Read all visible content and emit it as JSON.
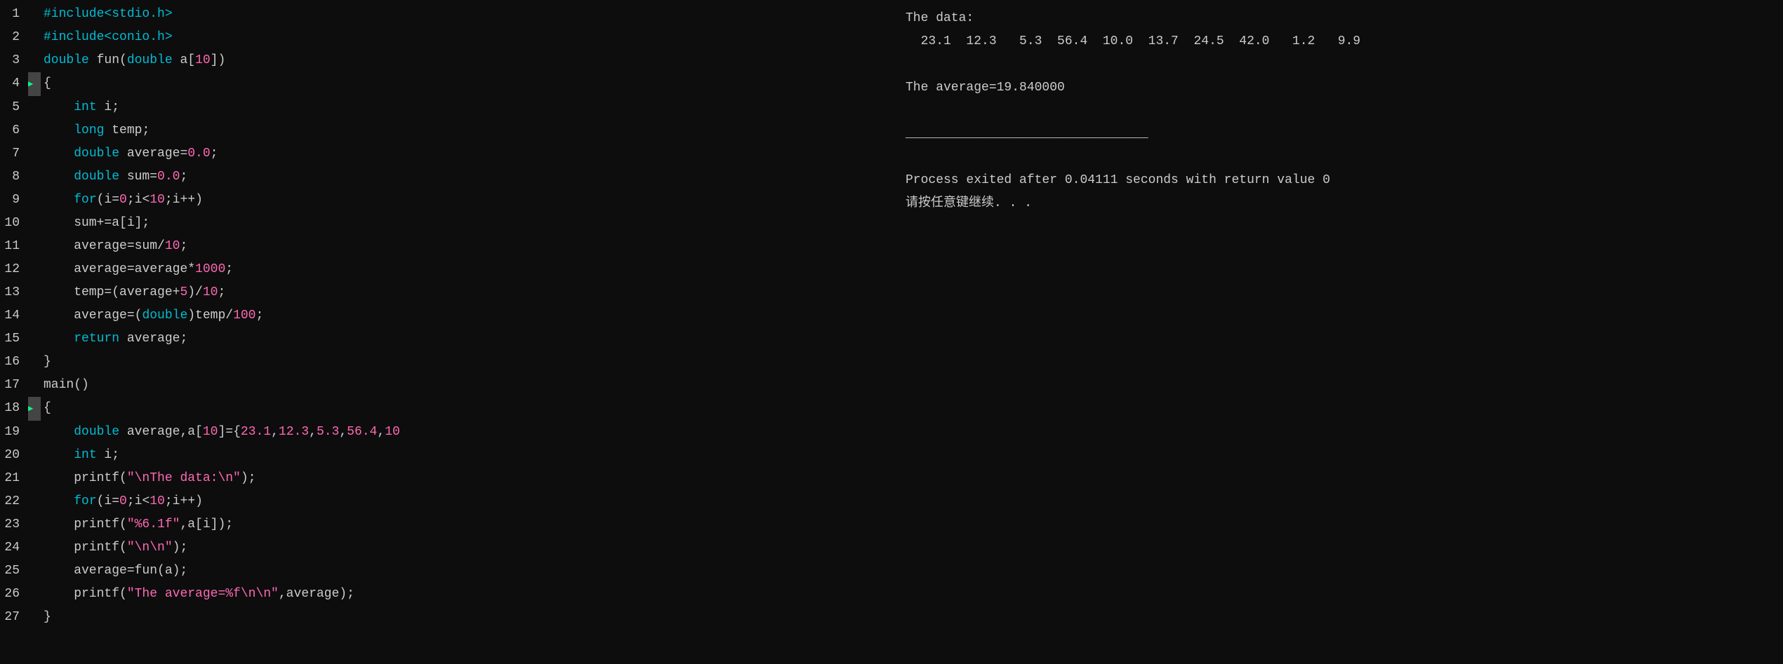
{
  "editor": {
    "lines": [
      {
        "num": 1,
        "marker": "",
        "content": "<span class='kw-include'>#include&lt;stdio.h&gt;</span>"
      },
      {
        "num": 2,
        "marker": "",
        "content": "<span class='kw-include'>#include&lt;conio.h&gt;</span>"
      },
      {
        "num": 3,
        "marker": "",
        "content": "<span class='kw-type'>double</span> fun(<span class='kw-type'>double</span> a[<span class='num-val'>10</span>])"
      },
      {
        "num": 4,
        "marker": "■",
        "content": "{"
      },
      {
        "num": 5,
        "marker": "",
        "content": "    <span class='kw-type'>int</span> i;"
      },
      {
        "num": 6,
        "marker": "",
        "content": "    <span class='kw-type'>long</span> temp;"
      },
      {
        "num": 7,
        "marker": "",
        "content": "    <span class='kw-type'>double</span> average=<span class='num-val'>0.0</span>;"
      },
      {
        "num": 8,
        "marker": "",
        "content": "    <span class='kw-type'>double</span> sum=<span class='num-val'>0.0</span>;"
      },
      {
        "num": 9,
        "marker": "",
        "content": "    <span class='kw-for'>for</span>(i=<span class='num-val'>0</span>;i&lt;<span class='num-val'>10</span>;i++)"
      },
      {
        "num": 10,
        "marker": "",
        "content": "    sum+=a[i];"
      },
      {
        "num": 11,
        "marker": "",
        "content": "    average=sum/<span class='num-val'>10</span>;"
      },
      {
        "num": 12,
        "marker": "",
        "content": "    average=average*<span class='num-val'>1000</span>;"
      },
      {
        "num": 13,
        "marker": "",
        "content": "    temp=(average+<span class='num-val'>5</span>)/<span class='num-val'>10</span>;"
      },
      {
        "num": 14,
        "marker": "",
        "content": "    average=(<span class='kw-type'>double</span>)temp/<span class='num-val'>100</span>;"
      },
      {
        "num": 15,
        "marker": "",
        "content": "    <span class='kw-return'>return</span> average;"
      },
      {
        "num": 16,
        "marker": "",
        "content": "}"
      },
      {
        "num": 17,
        "marker": "",
        "content": "main()"
      },
      {
        "num": 18,
        "marker": "■",
        "content": "{"
      },
      {
        "num": 19,
        "marker": "",
        "content": "    <span class='kw-type'>double</span> average,a[<span class='num-val'>10</span>]={<span class='num-val'>23.1</span>,<span class='num-val'>12.3</span>,<span class='num-val'>5.3</span>,<span class='num-val'>56.4</span>,<span class='num-val'>10</span>"
      },
      {
        "num": 20,
        "marker": "",
        "content": "    <span class='kw-type'>int</span> i;"
      },
      {
        "num": 21,
        "marker": "",
        "content": "    printf(<span class='str-val'>&quot;\\nThe data:\\n&quot;</span>);"
      },
      {
        "num": 22,
        "marker": "",
        "content": "    <span class='kw-for'>for</span>(i=<span class='num-val'>0</span>;i&lt;<span class='num-val'>10</span>;i++)"
      },
      {
        "num": 23,
        "marker": "",
        "content": "    printf(<span class='str-val'>&quot;%6.1f&quot;</span>,a[i]);"
      },
      {
        "num": 24,
        "marker": "",
        "content": "    printf(<span class='str-val'>&quot;\\n\\n&quot;</span>);"
      },
      {
        "num": 25,
        "marker": "",
        "content": "    average=fun(a);"
      },
      {
        "num": 26,
        "marker": "",
        "content": "    printf(<span class='str-val'>&quot;The average=%f\\n\\n&quot;</span>,average);"
      },
      {
        "num": 27,
        "marker": "",
        "content": "}"
      }
    ]
  },
  "output": {
    "lines": [
      {
        "text": "The data:"
      },
      {
        "text": "  23.1  12.3   5.3  56.4  10.0  13.7  24.5  42.0   1.2   9.9"
      },
      {
        "text": ""
      },
      {
        "text": "The average=19.840000"
      },
      {
        "text": ""
      },
      {
        "text": "________________________________"
      },
      {
        "text": ""
      },
      {
        "text": "Process exited after 0.04111 seconds with return value 0"
      },
      {
        "text": "请按任意键继续. . ."
      }
    ]
  }
}
